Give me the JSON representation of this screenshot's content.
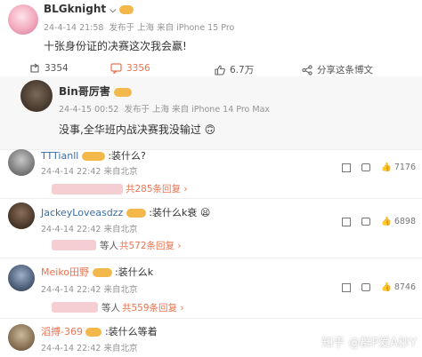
{
  "post": {
    "author": "BLGknight",
    "time": "24-4-14 21:58",
    "source": "发布于 上海 来自 iPhone 15 Pro",
    "text": "十张身份证的决赛这次我会赢!",
    "actions": {
      "repost": "3354",
      "comment": "3356",
      "like": "6.7万",
      "share": "分享这条博文"
    }
  },
  "reply_post": {
    "author": "Bin哥厉害",
    "time": "24-4-15 00:52",
    "source": "发布于 上海 来自 iPhone 14 Pro Max",
    "text": "没事,全华班内战决赛我没输过",
    "emoji": "🙃"
  },
  "comments": [
    {
      "author": "TTTianll",
      "text": ":装什么?",
      "time": "24-4-14 22:42 来自北京",
      "likes": "7176",
      "replies": "共285条回复"
    },
    {
      "author": "JackeyLoveasdzz",
      "text": ":装什么k衰",
      "emoji": "😫",
      "time": "24-4-14 22:42 来自北京",
      "likes": "6898",
      "sub_label": "等人",
      "replies": "共572条回复"
    },
    {
      "author": "Meiko田野",
      "text": ":装什么k",
      "time": "24-4-14 22:42 来自北京",
      "likes": "8746",
      "sub_label": "等人",
      "replies": "共559条回复"
    },
    {
      "author": "滔搏-369",
      "text": ":装什么等着",
      "time": "24-4-14 22:42 来自北京"
    }
  ],
  "watermark": "知乎 @群P爱A秒Y",
  "colors": {
    "accent": "#eb7350",
    "name_blue": "#3b6ea8",
    "name_orange": "#eb7350",
    "name_dark": "#333333",
    "meta_gray": "#939393",
    "badge_gold": "#f2b84b"
  }
}
